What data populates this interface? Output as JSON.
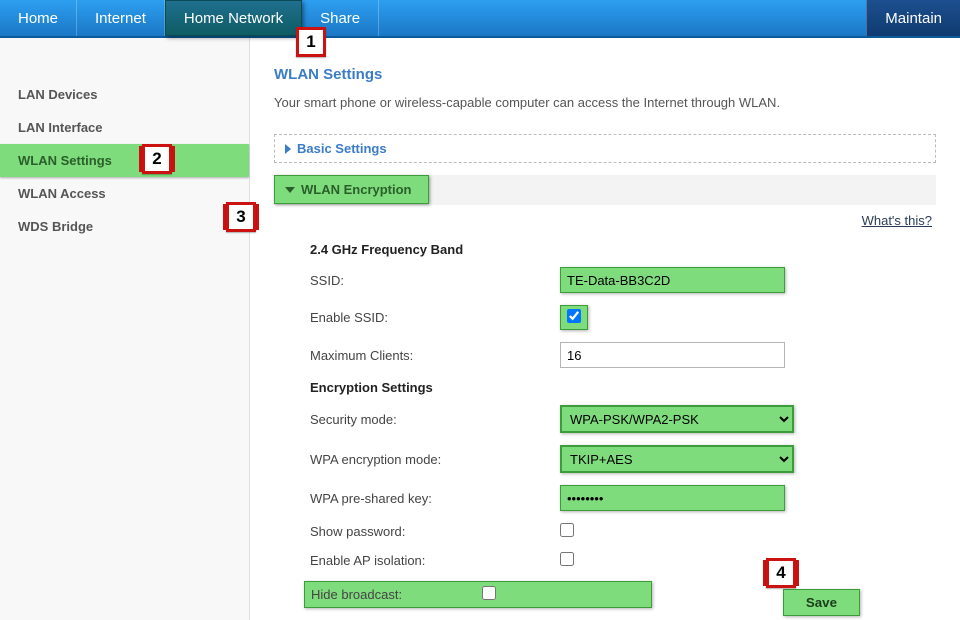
{
  "nav": {
    "home": "Home",
    "internet": "Internet",
    "home_network": "Home Network",
    "share": "Share",
    "maintain": "Maintain"
  },
  "sidebar": {
    "lan_devices": "LAN Devices",
    "lan_interface": "LAN Interface",
    "wlan_settings": "WLAN Settings",
    "wlan_access": "WLAN Access",
    "wds_bridge": "WDS Bridge"
  },
  "page": {
    "title": "WLAN Settings",
    "desc": "Your smart phone or wireless-capable computer can access the Internet through WLAN.",
    "whats_this": "What's this?"
  },
  "panels": {
    "basic": "Basic Settings",
    "encryption": "WLAN Encryption"
  },
  "form": {
    "band_hdr": "2.4 GHz Frequency Band",
    "ssid_lbl": "SSID:",
    "ssid_val": "TE-Data-BB3C2D",
    "enable_ssid_lbl": "Enable SSID:",
    "enable_ssid_val": true,
    "max_clients_lbl": "Maximum Clients:",
    "max_clients_val": "16",
    "enc_hdr": "Encryption Settings",
    "sec_mode_lbl": "Security mode:",
    "sec_mode_val": "WPA-PSK/WPA2-PSK",
    "wpa_enc_lbl": "WPA encryption mode:",
    "wpa_enc_val": "TKIP+AES",
    "psk_lbl": "WPA pre-shared key:",
    "psk_val": "••••••••",
    "show_pw_lbl": "Show password:",
    "ap_iso_lbl": "Enable AP isolation:",
    "hide_bc_lbl": "Hide broadcast:",
    "save": "Save"
  },
  "callouts": {
    "c1": "1",
    "c2": "2",
    "c3": "3",
    "c4": "4"
  }
}
